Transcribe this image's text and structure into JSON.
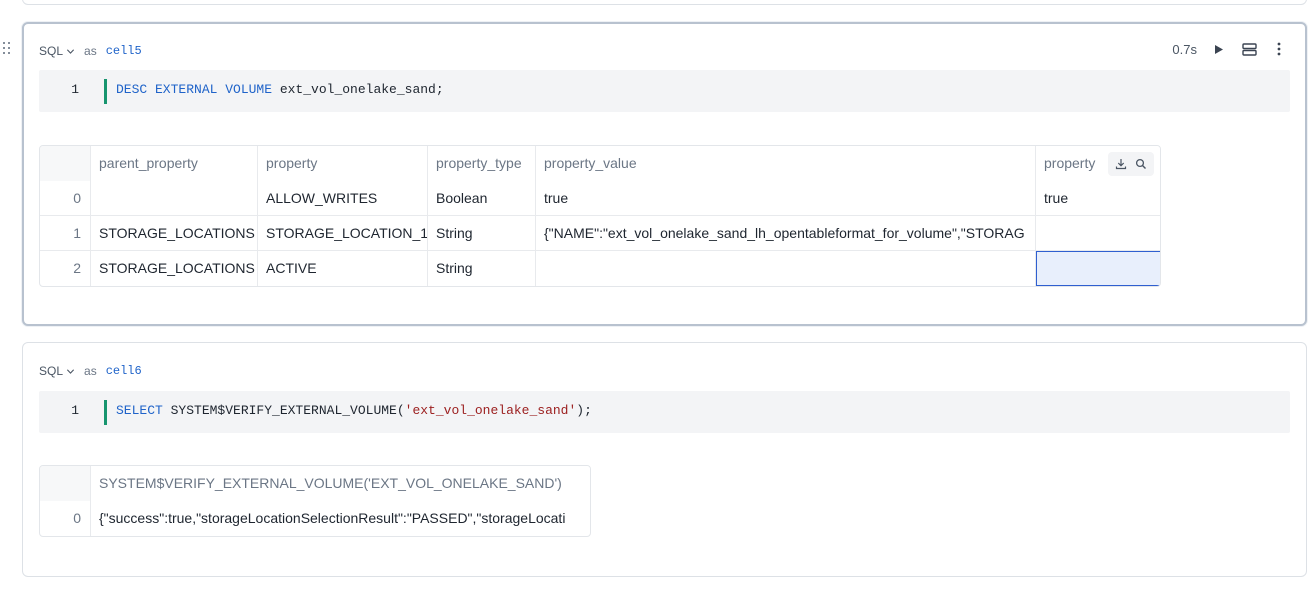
{
  "cell5": {
    "language": "SQL",
    "as_label": "as",
    "name": "cell5",
    "timing": "0.7s",
    "editor": {
      "line_number": "1",
      "code_tokens": [
        {
          "text": "DESC EXTERNAL VOLUME",
          "type": "keyword"
        },
        {
          "text": " ext_vol_onelake_sand;",
          "type": "plain"
        }
      ]
    },
    "result": {
      "columns": [
        "",
        "parent_property",
        "property",
        "property_type",
        "property_value",
        "property"
      ],
      "rows": [
        [
          "0",
          "",
          "ALLOW_WRITES",
          "Boolean",
          "true",
          "true"
        ],
        [
          "1",
          "STORAGE_LOCATIONS",
          "STORAGE_LOCATION_1",
          "String",
          "{\"NAME\":\"ext_vol_onelake_sand_lh_opentableformat_for_volume\",\"STORAG",
          ""
        ],
        [
          "2",
          "STORAGE_LOCATIONS",
          "ACTIVE",
          "String",
          "",
          ""
        ]
      ]
    }
  },
  "cell6": {
    "language": "SQL",
    "as_label": "as",
    "name": "cell6",
    "editor": {
      "line_number": "1",
      "code_tokens": [
        {
          "text": "SELECT",
          "type": "keyword"
        },
        {
          "text": " SYSTEM$VERIFY_EXTERNAL_VOLUME(",
          "type": "plain"
        },
        {
          "text": "'ext_vol_onelake_sand'",
          "type": "string"
        },
        {
          "text": ");",
          "type": "plain"
        }
      ]
    },
    "result": {
      "columns": [
        "",
        "SYSTEM$VERIFY_EXTERNAL_VOLUME('EXT_VOL_ONELAKE_SAND')"
      ],
      "rows": [
        [
          "0",
          "{\"success\":true,\"storageLocationSelectionResult\":\"PASSED\",\"storageLocati"
        ]
      ]
    }
  },
  "icons": {
    "run": "play-icon",
    "layout": "stack-icon",
    "more": "more-vertical-icon",
    "download": "download-icon",
    "search": "search-icon",
    "chevron": "chevron-down-icon",
    "drag": "drag-handle-icon"
  },
  "colors": {
    "keyword": "#1f63c9",
    "string": "#9c2020",
    "gutter_accent": "#17956f",
    "selection": "#2f5fd0"
  }
}
